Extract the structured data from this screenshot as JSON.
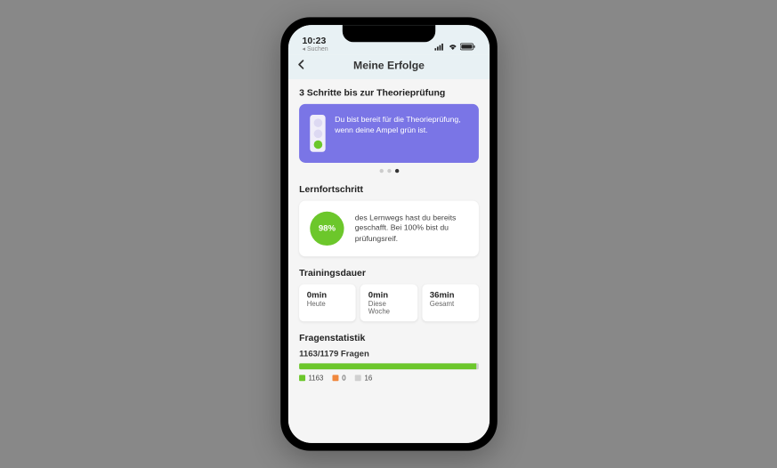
{
  "status": {
    "time": "10:23",
    "back_label": "◂ Suchen"
  },
  "header": {
    "title": "Meine Erfolge"
  },
  "steps": {
    "title": "3 Schritte bis zur Theorieprüfung",
    "banner_text": "Du bist bereit für die Theorieprüfung, wenn deine Ampel grün ist."
  },
  "progress": {
    "title": "Lernfortschritt",
    "percent": "98%",
    "text": "des Lernwegs hast du bereits geschafft. Bei 100% bist du prüfungsreif."
  },
  "training": {
    "title": "Trainingsdauer",
    "items": [
      {
        "value": "0min",
        "label": "Heute"
      },
      {
        "value": "0min",
        "label": "Diese Woche"
      },
      {
        "value": "36min",
        "label": "Gesamt"
      }
    ]
  },
  "stats": {
    "title": "Fragenstatistik",
    "summary": "1163/1179 Fragen",
    "correct": 1163,
    "wrong": 0,
    "open": 16,
    "total": 1179,
    "colors": {
      "correct": "#6cc72b",
      "wrong": "#f0883e",
      "open": "#d0d0d0"
    }
  }
}
